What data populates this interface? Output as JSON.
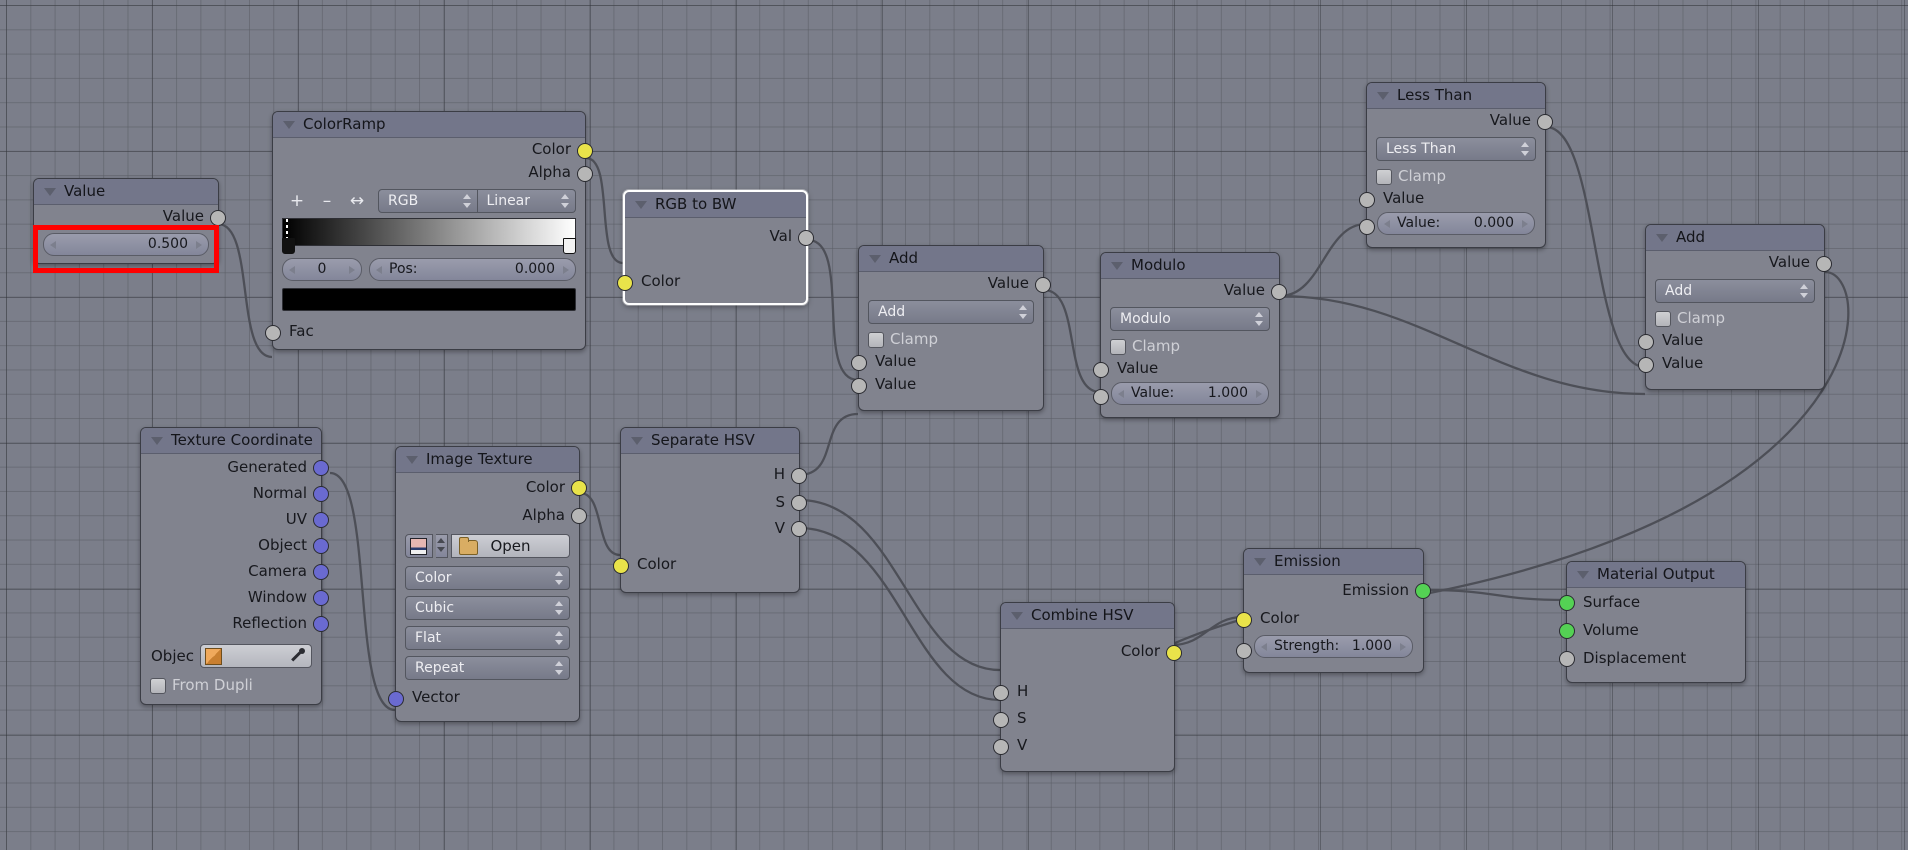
{
  "app": {
    "editor": "blender-shader-node-editor",
    "background_color": "#7b7e8a",
    "node_color": "#81838e",
    "header_color": "#73768a",
    "highlight_color": "#ff0000"
  },
  "annotation": {
    "name": "value-field-highlight",
    "color": "#ff0000",
    "target": "Value node number field 0.500"
  },
  "nodes": {
    "value": {
      "title": "Value",
      "outputs": [
        {
          "label": "Value",
          "color": "gray"
        }
      ],
      "fields": [
        {
          "label": "",
          "value": "0.500"
        }
      ]
    },
    "color_ramp": {
      "title": "ColorRamp",
      "outputs": [
        {
          "label": "Color",
          "color": "yellow"
        },
        {
          "label": "Alpha",
          "color": "gray"
        }
      ],
      "tools": [
        "+",
        "–",
        "↔"
      ],
      "color_mode": "RGB",
      "interpolation": "Linear",
      "stop_index": "0",
      "pos_label": "Pos:",
      "pos_value": "0.000",
      "swatch_color": "#000000",
      "inputs": [
        {
          "label": "Fac",
          "color": "gray"
        }
      ]
    },
    "rgb_to_bw": {
      "title": "RGB to BW",
      "selected": true,
      "outputs": [
        {
          "label": "Val",
          "color": "gray"
        }
      ],
      "inputs": [
        {
          "label": "Color",
          "color": "yellow"
        }
      ]
    },
    "math_add_1": {
      "title": "Add",
      "outputs": [
        {
          "label": "Value",
          "color": "gray"
        }
      ],
      "operation": "Add",
      "clamp_label": "Clamp",
      "inputs": [
        {
          "label": "Value",
          "color": "gray"
        },
        {
          "label": "Value",
          "color": "gray"
        }
      ]
    },
    "math_modulo": {
      "title": "Modulo",
      "outputs": [
        {
          "label": "Value",
          "color": "gray"
        }
      ],
      "operation": "Modulo",
      "clamp_label": "Clamp",
      "inputs": [
        {
          "label": "Value",
          "color": "gray"
        },
        {
          "label": "Value:",
          "color": "gray",
          "value": "1.000"
        }
      ]
    },
    "math_less_than": {
      "title": "Less Than",
      "outputs": [
        {
          "label": "Value",
          "color": "gray"
        }
      ],
      "operation": "Less Than",
      "clamp_label": "Clamp",
      "inputs": [
        {
          "label": "Value",
          "color": "gray"
        },
        {
          "label": "Value:",
          "color": "gray",
          "value": "0.000"
        }
      ]
    },
    "math_add_2": {
      "title": "Add",
      "outputs": [
        {
          "label": "Value",
          "color": "gray"
        }
      ],
      "operation": "Add",
      "clamp_label": "Clamp",
      "inputs": [
        {
          "label": "Value",
          "color": "gray"
        },
        {
          "label": "Value",
          "color": "gray"
        }
      ]
    },
    "texture_coordinate": {
      "title": "Texture Coordinate",
      "outputs": [
        {
          "label": "Generated",
          "color": "blue"
        },
        {
          "label": "Normal",
          "color": "blue"
        },
        {
          "label": "UV",
          "color": "blue"
        },
        {
          "label": "Object",
          "color": "blue"
        },
        {
          "label": "Camera",
          "color": "blue"
        },
        {
          "label": "Window",
          "color": "blue"
        },
        {
          "label": "Reflection",
          "color": "blue"
        }
      ],
      "object_label": "Objec",
      "from_dupli_label": "From Dupli"
    },
    "image_texture": {
      "title": "Image Texture",
      "outputs": [
        {
          "label": "Color",
          "color": "yellow"
        },
        {
          "label": "Alpha",
          "color": "gray"
        }
      ],
      "open_label": "Open",
      "enums": [
        "Color",
        "Cubic",
        "Flat",
        "Repeat"
      ],
      "inputs": [
        {
          "label": "Vector",
          "color": "blue"
        }
      ]
    },
    "separate_hsv": {
      "title": "Separate HSV",
      "outputs": [
        {
          "label": "H",
          "color": "gray"
        },
        {
          "label": "S",
          "color": "gray"
        },
        {
          "label": "V",
          "color": "gray"
        }
      ],
      "inputs": [
        {
          "label": "Color",
          "color": "yellow"
        }
      ]
    },
    "combine_hsv": {
      "title": "Combine HSV",
      "outputs": [
        {
          "label": "Color",
          "color": "yellow"
        }
      ],
      "inputs": [
        {
          "label": "H",
          "color": "gray"
        },
        {
          "label": "S",
          "color": "gray"
        },
        {
          "label": "V",
          "color": "gray"
        }
      ]
    },
    "emission": {
      "title": "Emission",
      "outputs": [
        {
          "label": "Emission",
          "color": "green"
        }
      ],
      "inputs": [
        {
          "label": "Color",
          "color": "yellow"
        },
        {
          "label": "Strength:",
          "color": "gray",
          "value": "1.000"
        }
      ]
    },
    "material_output": {
      "title": "Material Output",
      "inputs": [
        {
          "label": "Surface",
          "color": "green"
        },
        {
          "label": "Volume",
          "color": "green"
        },
        {
          "label": "Displacement",
          "color": "gray"
        }
      ]
    }
  }
}
